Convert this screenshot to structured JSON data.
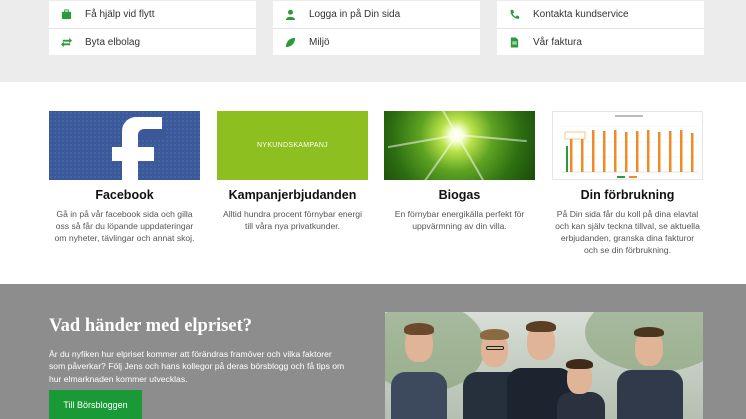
{
  "links": {
    "col1": [
      {
        "label": "Få hjälp vid flytt",
        "icon": "briefcase-icon"
      },
      {
        "label": "Byta elbolag",
        "icon": "swap-arrows-icon"
      }
    ],
    "col2": [
      {
        "label": "Logga in på Din sida",
        "icon": "user-icon"
      },
      {
        "label": "Miljö",
        "icon": "leaf-icon"
      }
    ],
    "col3": [
      {
        "label": "Kontakta kundservice",
        "icon": "phone-icon"
      },
      {
        "label": "Vår faktura",
        "icon": "document-icon"
      }
    ]
  },
  "cards": [
    {
      "title": "Facebook",
      "text": "Gå in på vår facebook sida och gilla oss så får du löpande uppdateringar om nyheter, tävlingar och annat skoj."
    },
    {
      "title": "Kampanjerbjudanden",
      "text": "Alltid hundra procent förnybar energi till våra nya privatkunder.",
      "thumb_text": "NYKUNDSKAMPANJ"
    },
    {
      "title": "Biogas",
      "text": "En förnybar energikälla perfekt för uppvärmning av din villa."
    },
    {
      "title": "Din förbrukning",
      "text": "På Din sida får du koll på dina elavtal och kan själv teckna tillval, se aktuella erbjudanden, granska dina fakturor och se din förbrukning."
    }
  ],
  "elpris": {
    "heading": "Vad händer med elpriset?",
    "text": "Är du nyfiken hur elpriset kommer att förändras framöver och vilka faktorer som påverkar? Följ Jens och hans kollegor på deras börsblogg och få tips om hur elmarknaden kommer utvecklas.",
    "button": "Till Börsbloggen"
  },
  "colors": {
    "accent": "#1a9a36",
    "icon": "#2a9a3c",
    "band": "#ececec",
    "lower": "#8d8d8d"
  }
}
